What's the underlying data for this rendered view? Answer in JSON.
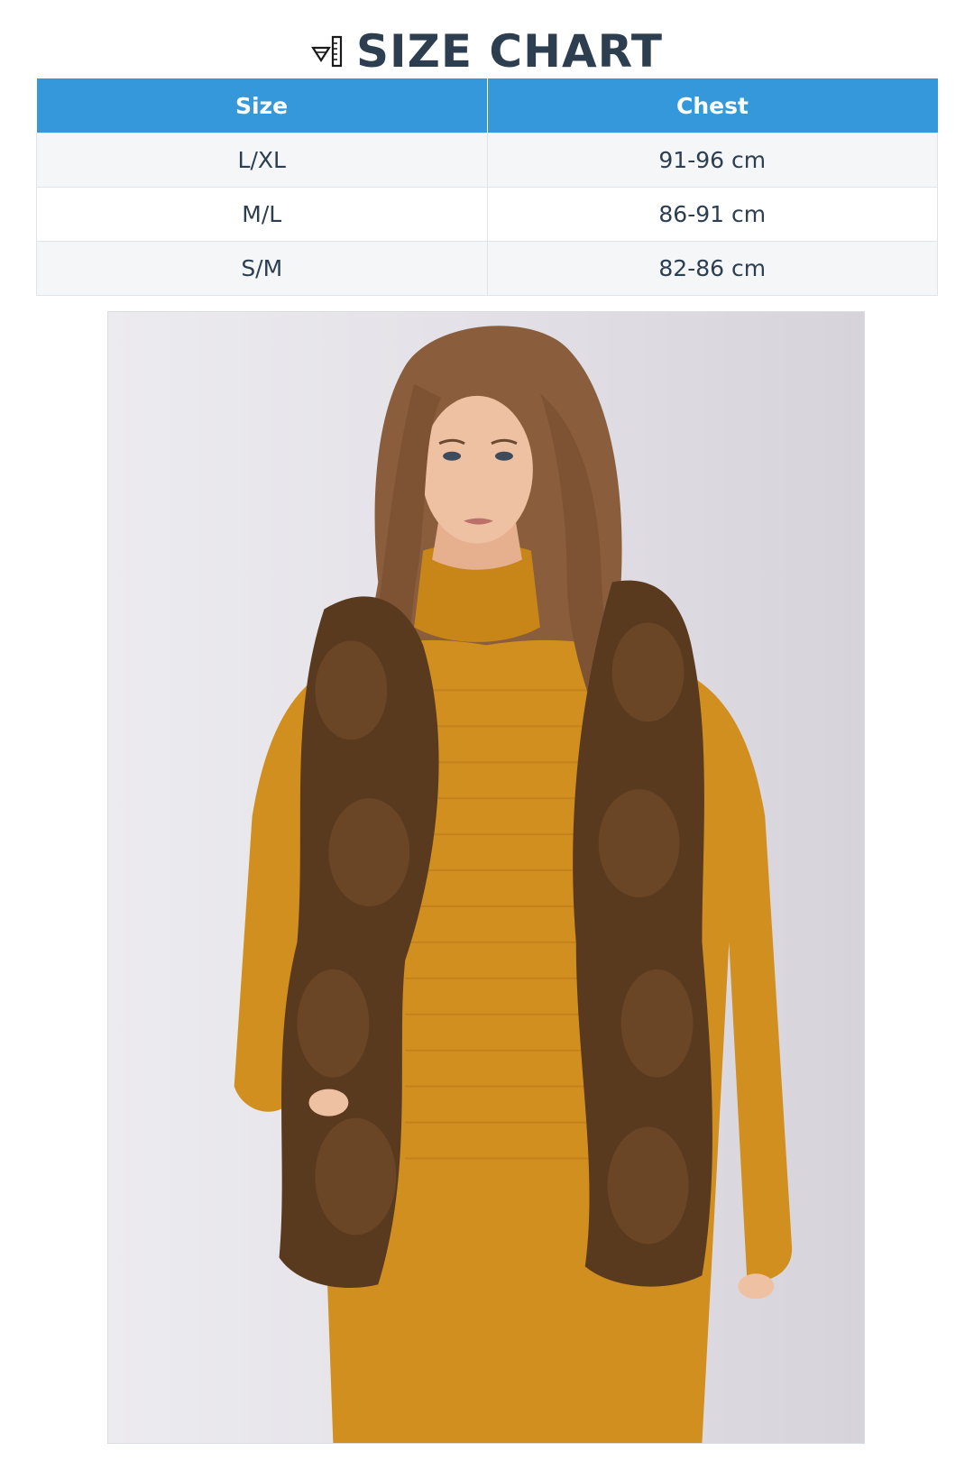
{
  "header": {
    "title": "SIZE CHART",
    "icon": "ruler-icon"
  },
  "table": {
    "columns": [
      "Size",
      "Chest"
    ],
    "rows": [
      {
        "size": "L/XL",
        "chest": "91-96 cm"
      },
      {
        "size": "M/L",
        "chest": "86-91 cm"
      },
      {
        "size": "S/M",
        "chest": "82-86 cm"
      }
    ]
  },
  "colors": {
    "header_bg": "#3498db",
    "title_text": "#2c3e50",
    "sweater": "#d18f1f",
    "fur": "#5a3a1f"
  }
}
